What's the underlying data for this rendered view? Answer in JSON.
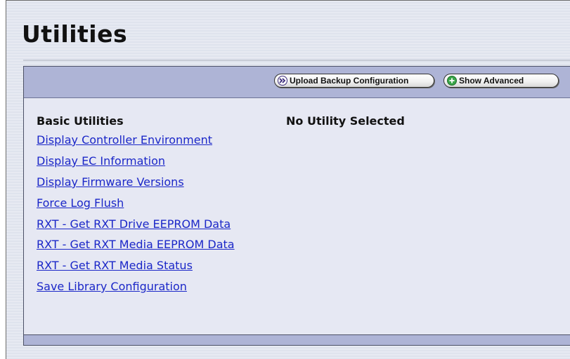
{
  "page": {
    "title": "Utilities"
  },
  "toolbar": {
    "upload_label": "Upload Backup Configuration",
    "upload_icon": "double-chevron-right-icon",
    "advanced_label": "Show Advanced",
    "advanced_icon": "plus-circle-icon"
  },
  "basic_utilities": {
    "heading": "Basic Utilities",
    "items": [
      {
        "label": "Display Controller Environment"
      },
      {
        "label": "Display EC Information"
      },
      {
        "label": "Display Firmware Versions"
      },
      {
        "label": "Force Log Flush"
      },
      {
        "label": "RXT - Get RXT Drive EEPROM Data"
      },
      {
        "label": "RXT - Get RXT Media EEPROM Data"
      },
      {
        "label": "RXT - Get RXT Media Status"
      },
      {
        "label": "Save Library Configuration"
      }
    ]
  },
  "detail": {
    "status_text": "No Utility Selected"
  },
  "colors": {
    "toolbar_bg": "#aeb4d6",
    "panel_bg": "#e6e8f3",
    "link": "#1b27c8",
    "plus_icon": "#3aa64a"
  }
}
